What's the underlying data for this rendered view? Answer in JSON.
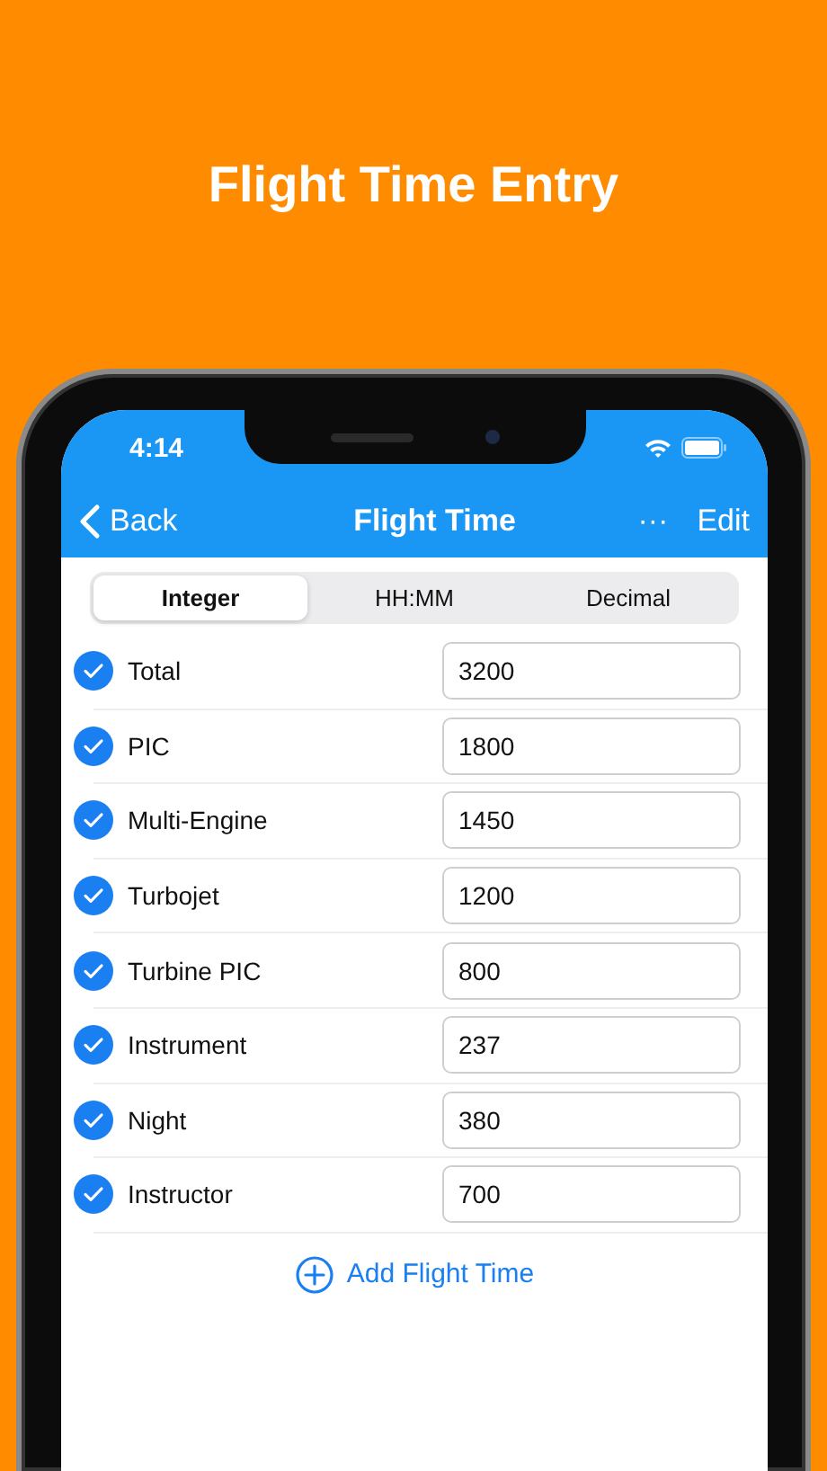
{
  "headline": "Flight Time Entry",
  "status_bar": {
    "time": "4:14"
  },
  "nav": {
    "back": "Back",
    "title": "Flight Time",
    "more": "···",
    "edit": "Edit"
  },
  "segments": [
    {
      "label": "Integer",
      "selected": true
    },
    {
      "label": "HH:MM",
      "selected": false
    },
    {
      "label": "Decimal",
      "selected": false
    }
  ],
  "rows": [
    {
      "label": "Total",
      "value": "3200",
      "checked": true
    },
    {
      "label": "PIC",
      "value": "1800",
      "checked": true
    },
    {
      "label": "Multi-Engine",
      "value": "1450",
      "checked": true
    },
    {
      "label": "Turbojet",
      "value": "1200",
      "checked": true
    },
    {
      "label": "Turbine PIC",
      "value": "800",
      "checked": true
    },
    {
      "label": "Instrument",
      "value": "237",
      "checked": true
    },
    {
      "label": "Night",
      "value": "380",
      "checked": true
    },
    {
      "label": "Instructor",
      "value": "700",
      "checked": true
    }
  ],
  "add_button": "Add Flight Time"
}
